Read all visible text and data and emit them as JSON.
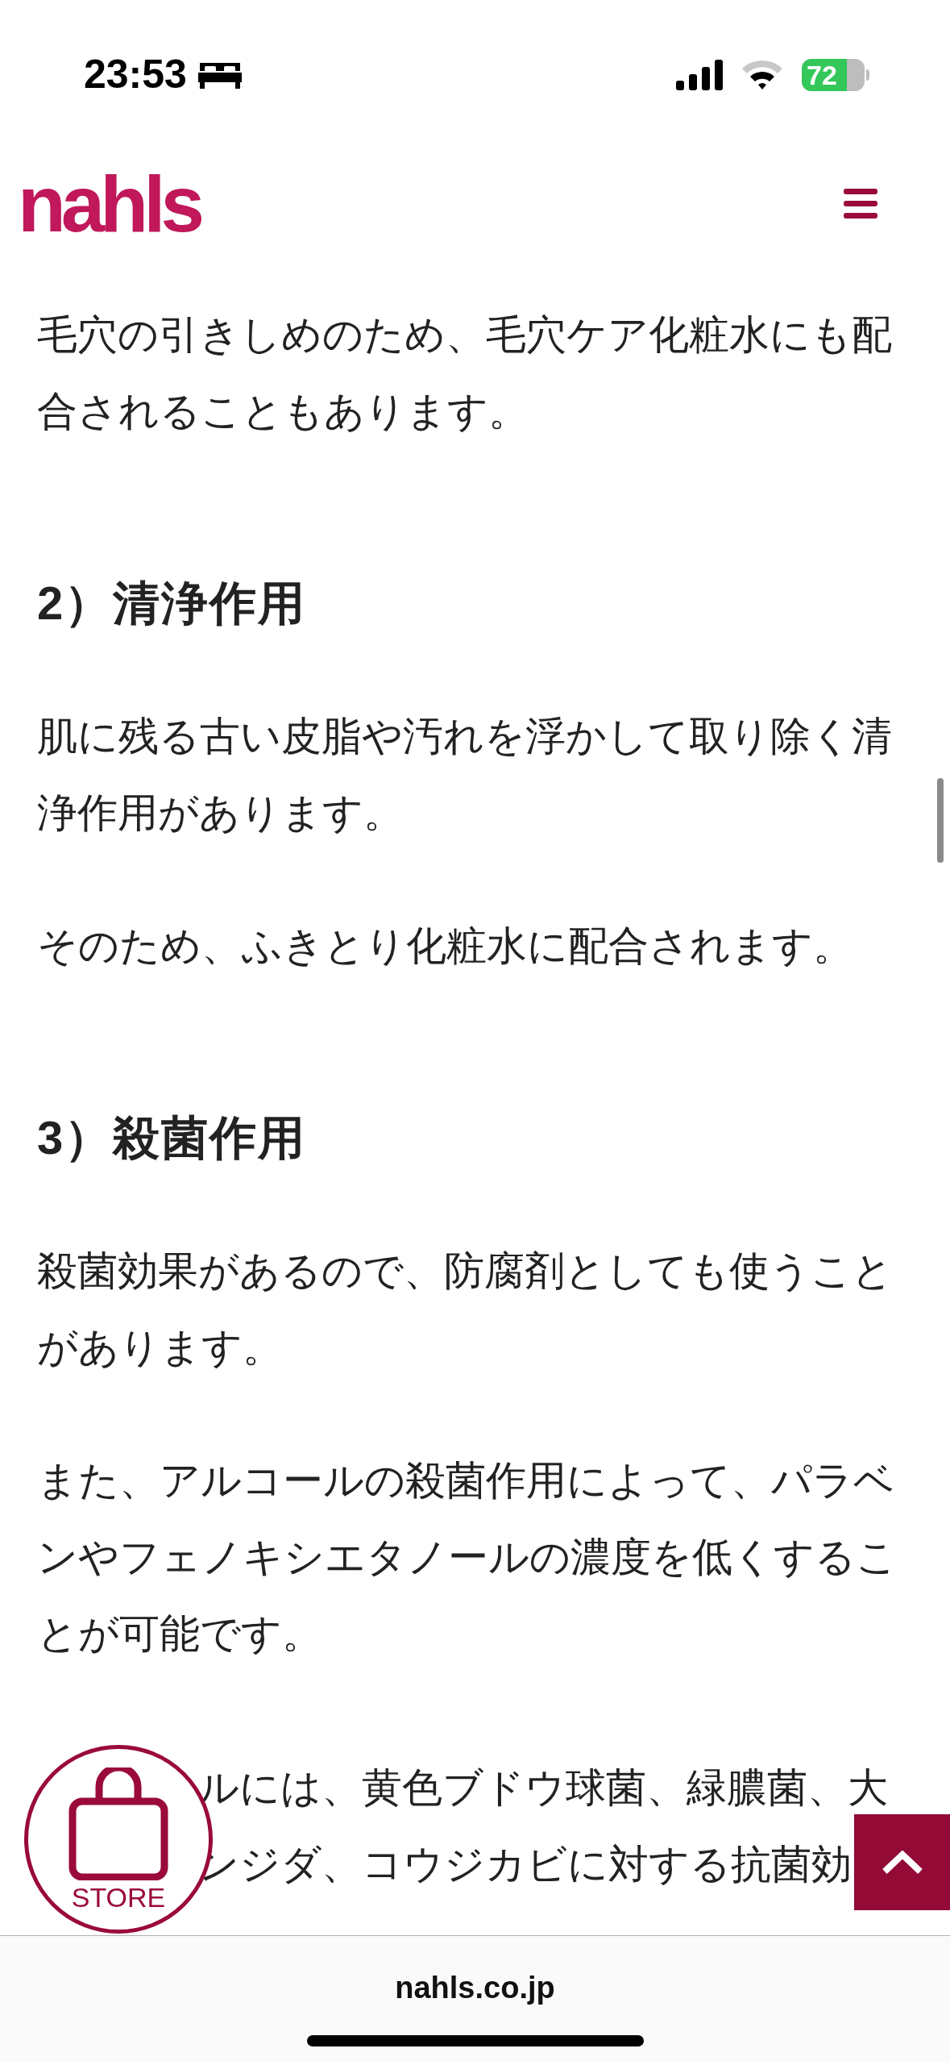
{
  "status_bar": {
    "time": "23:53",
    "battery": "72"
  },
  "header": {
    "logo": "nahls"
  },
  "content": [
    {
      "kind": "paragraph",
      "text": "毛穴の引きしめのため、毛穴ケア化粧水にも配合されることもあります。"
    },
    {
      "kind": "heading",
      "text": "2）清浄作用"
    },
    {
      "kind": "paragraph",
      "text": "肌に残る古い皮脂や汚れを浮かして取り除く清浄作用があります。"
    },
    {
      "kind": "paragraph",
      "text": "そのため、ふきとり化粧水に配合されます。"
    },
    {
      "kind": "heading",
      "text": "3）殺菌作用"
    },
    {
      "kind": "paragraph",
      "text": "殺菌効果があるので、防腐剤としても使うことがあります。"
    },
    {
      "kind": "paragraph",
      "text": "また、アルコールの殺菌作用によって、パラベンやフェノキシエタノールの濃度を低くすることが可能です。"
    },
    {
      "kind": "partial",
      "lines": [
        "ルには、黄色ブドウ球菌、緑膿菌、大",
        "ンジダ、コウジカビに対する抗菌効"
      ]
    }
  ],
  "store_button": {
    "label": "STORE"
  },
  "url_bar": {
    "domain": "nahls.co.jp"
  }
}
